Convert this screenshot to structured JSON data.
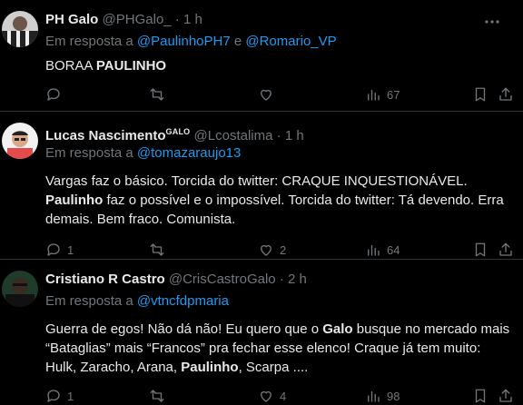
{
  "tweets": [
    {
      "name": "PH Galo",
      "badge": "",
      "handle": "@PHGalo_",
      "time": "1 h",
      "reply_prefix": "Em resposta a",
      "reply_to": [
        "@PaulinhoPH7",
        "@Romario_VP"
      ],
      "reply_joiner": "e",
      "lines": [
        [
          {
            "t": "BORAA ",
            "b": false
          },
          {
            "t": "PAULINHO",
            "b": true
          }
        ]
      ],
      "stats": {
        "replies": "",
        "retweets": "",
        "likes": "",
        "views": "67"
      }
    },
    {
      "name": "Lucas Nascimento",
      "badge": "GALO",
      "handle": "@Lcostalima",
      "time": "1 h",
      "reply_prefix": "Em resposta a",
      "reply_to": [
        "@tomazaraujo13"
      ],
      "reply_joiner": "",
      "lines": [
        [
          {
            "t": "Vargas faz o básico. Torcida do twitter: CRAQUE INQUESTIONÁVEL.",
            "b": false
          }
        ],
        [
          {
            "t": "Paulinho",
            "b": true
          },
          {
            "t": " faz o possível e o impossível. Torcida do twitter: Tá devendo. Erra",
            "b": false
          }
        ],
        [
          {
            "t": "demais. Bem fraco. Comunista.",
            "b": false
          }
        ]
      ],
      "stats": {
        "replies": "1",
        "retweets": "",
        "likes": "2",
        "views": "64"
      }
    },
    {
      "name": "Cristiano R Castro",
      "badge": "",
      "handle": "@CrisCastroGalo",
      "time": "2 h",
      "reply_prefix": "Em resposta a",
      "reply_to": [
        "@vtncfdpmaria"
      ],
      "reply_joiner": "",
      "lines": [
        [
          {
            "t": "Guerra de egos! Não dá não! Eu quero que o ",
            "b": false
          },
          {
            "t": "Galo",
            "b": true
          },
          {
            "t": " busque no mercado mais",
            "b": false
          }
        ],
        [
          {
            "t": "“Bataglias” mais “Francos” pra fechar esse elenco! Craque já tem muito:",
            "b": false
          }
        ],
        [
          {
            "t": "Hulk, Zaracho, Arana, ",
            "b": false
          },
          {
            "t": "Paulinho",
            "b": true
          },
          {
            "t": ", Scarpa ....",
            "b": false
          }
        ]
      ],
      "stats": {
        "replies": "1",
        "retweets": "",
        "likes": "4",
        "views": "98"
      }
    }
  ],
  "separator": "·",
  "icons": [
    "reply-icon",
    "retweet-icon",
    "like-icon",
    "views-icon",
    "bookmark-icon",
    "share-icon",
    "more-icon"
  ],
  "colors": {
    "background": "#000000",
    "text": "#e7e9ea",
    "muted": "#71767b",
    "link": "#1d9bf0",
    "divider": "#2f3336"
  }
}
